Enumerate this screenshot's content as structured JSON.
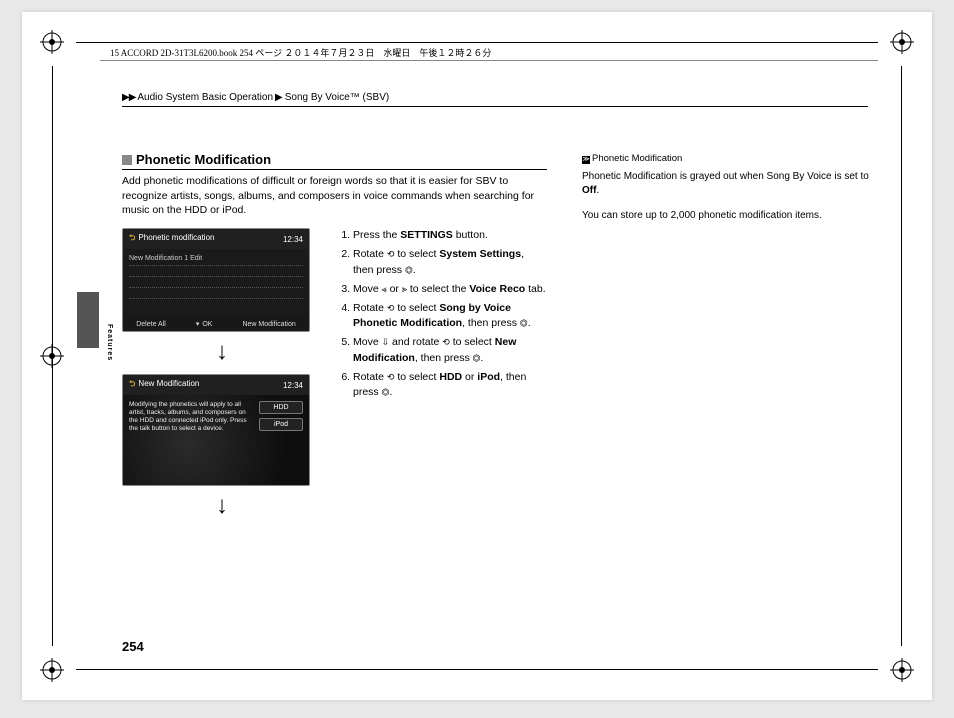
{
  "meta": {
    "header_line": "15 ACCORD 2D-31T3L6200.book  254 ページ  ２０１４年７月２３日　水曜日　午後１２時２６分"
  },
  "breadcrumb": {
    "arrows": "▶▶",
    "seg1": "Audio System Basic Operation",
    "sep": "▶",
    "seg2": "Song By Voice™ (SBV)"
  },
  "section": {
    "title": "Phonetic Modification",
    "intro": "Add phonetic modifications of difficult or foreign words so that it is easier for SBV to recognize artists, songs, albums, and composers in voice commands when searching for music on the HDD or iPod."
  },
  "screens": {
    "a": {
      "title": "Phonetic modification",
      "clock": "12:34",
      "subtitle": "New Modification 1 Edit",
      "footer_left": "Delete All",
      "footer_mid": "OK",
      "footer_right": "New Modification"
    },
    "b": {
      "title": "New Modification",
      "clock": "12:34",
      "text": "Modifying the phonetics will apply to all artist, tracks, albums, and composers on the HDD and connected iPod only. Press the talk button to select a device.",
      "btn1": "HDD",
      "btn2": "iPod"
    }
  },
  "steps": {
    "s1a": "Press the ",
    "s1b": "SETTINGS",
    "s1c": " button.",
    "s2a": "Rotate ",
    "s2b": " to select ",
    "s2c": "System Settings",
    "s2d": ", then press ",
    "s2e": ".",
    "s3a": "Move ",
    "s3b": " or ",
    "s3c": " to select the ",
    "s3d": "Voice Reco",
    "s3e": " tab.",
    "s4a": "Rotate ",
    "s4b": " to select ",
    "s4c": "Song by Voice Phonetic Modification",
    "s4d": ", then press ",
    "s4e": ".",
    "s5a": "Move ",
    "s5b": " and rotate ",
    "s5c": " to select ",
    "s5d": "New Modification",
    "s5e": ", then press ",
    "s5f": ".",
    "s6a": "Rotate ",
    "s6b": " to select ",
    "s6c": "HDD",
    "s6d": " or ",
    "s6e": "iPod",
    "s6f": ", then press ",
    "s6g": "."
  },
  "sidebar": {
    "heading": "Phonetic Modification",
    "p1a": "Phonetic Modification is grayed out when Song By Voice is set to ",
    "p1b": "Off",
    "p1c": ".",
    "p2": "You can store up to 2,000 phonetic modification items."
  },
  "chrome": {
    "side_label": "Features",
    "page_number": "254"
  },
  "glyphs": {
    "rotate": "⟲",
    "press": "⏣",
    "left": "⪡",
    "right": "⪢",
    "down": "⇩"
  }
}
